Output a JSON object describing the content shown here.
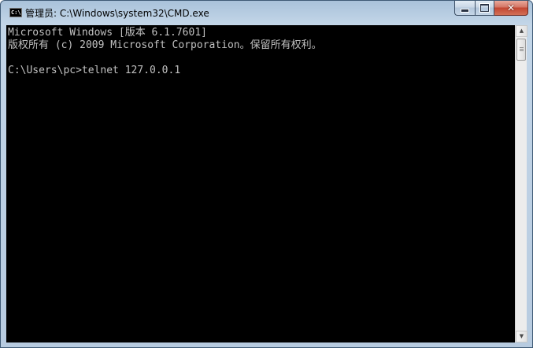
{
  "window": {
    "title": "管理员: C:\\Windows\\system32\\CMD.exe",
    "icon": "cmd-icon",
    "icon_label": "C:\\"
  },
  "caption_buttons": {
    "minimize_icon": "minimize-icon",
    "maximize_icon": "maximize-icon",
    "close_icon": "close-icon",
    "close_glyph": "✕"
  },
  "console": {
    "lines": [
      "Microsoft Windows [版本 6.1.7601]",
      "版权所有 (c) 2009 Microsoft Corporation。保留所有权利。",
      "",
      "C:\\Users\\pc>telnet 127.0.0.1"
    ],
    "text_color": "#c0c0c0",
    "background": "#000000"
  },
  "scrollbar": {
    "up_arrow": "▲",
    "down_arrow": "▼"
  }
}
